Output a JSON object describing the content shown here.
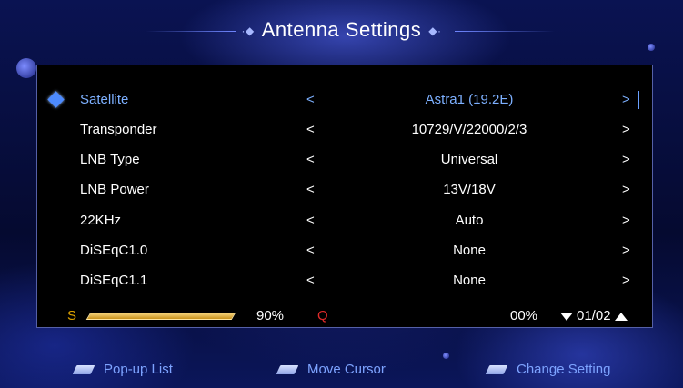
{
  "header": {
    "title": "Antenna Settings"
  },
  "settings": [
    {
      "label": "Satellite",
      "value": "Astra1 (19.2E)",
      "prev": "<",
      "next": ">"
    },
    {
      "label": "Transponder",
      "value": "10729/V/22000/2/3",
      "prev": "<",
      "next": ">"
    },
    {
      "label": "LNB Type",
      "value": "Universal",
      "prev": "<",
      "next": ">"
    },
    {
      "label": "LNB Power",
      "value": "13V/18V",
      "prev": "<",
      "next": ">"
    },
    {
      "label": "22KHz",
      "value": "Auto",
      "prev": "<",
      "next": ">"
    },
    {
      "label": "DiSEqC1.0",
      "value": "None",
      "prev": "<",
      "next": ">"
    },
    {
      "label": "DiSEqC1.1",
      "value": "None",
      "prev": "<",
      "next": ">"
    }
  ],
  "signal": {
    "strength_label": "S",
    "strength_value": 0.9,
    "strength_text": "90%",
    "quality_label": "Q",
    "quality_value": 0.0,
    "quality_text": "00%"
  },
  "pager": {
    "text": "01/02"
  },
  "footer": {
    "popup": "Pop-up List",
    "move": "Move Cursor",
    "change": "Change Setting"
  },
  "colors": {
    "selected_text": "#7db0ff",
    "strength": "#e0a400",
    "quality": "#e02a2a",
    "footer_text": "#7da3ff"
  },
  "icons": {
    "selected": "diamond-icon",
    "page_down": "triangle-down-icon",
    "page_up": "triangle-up-icon",
    "ok_key": "ok-key-icon",
    "updown_key": "updown-key-icon",
    "leftright_key": "leftright-key-icon"
  }
}
